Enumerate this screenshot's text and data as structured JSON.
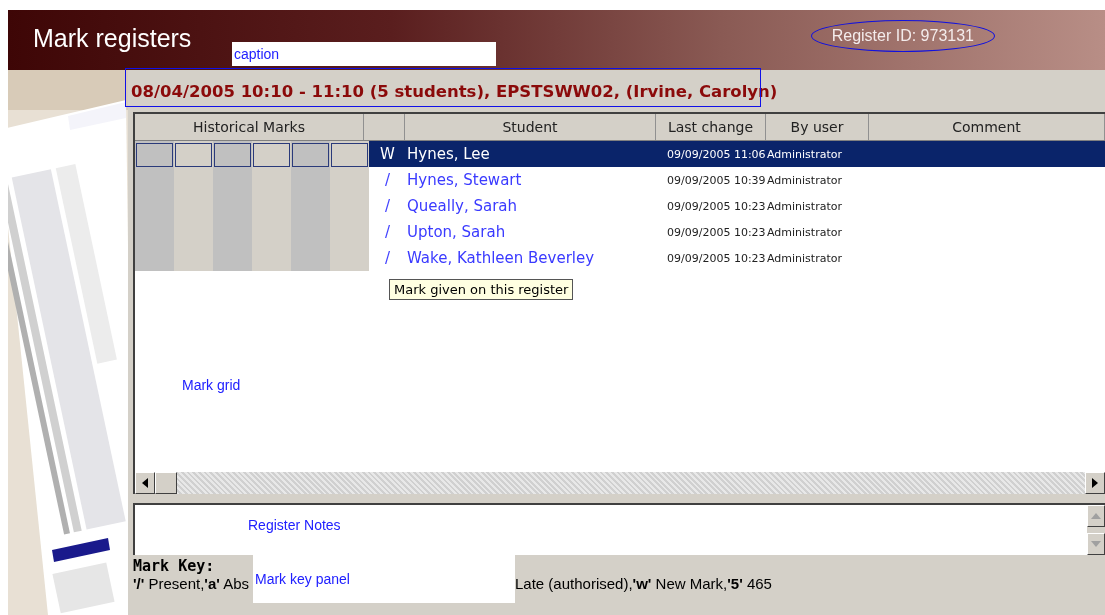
{
  "header": {
    "title": "Mark registers",
    "register_id": "Register ID: 973131",
    "register_id_circled": true
  },
  "caption_label": {
    "text": "caption",
    "boxed": true
  },
  "caption": {
    "text": "08/04/2005 10:10 - 11:10 (5 students), EPSTSWW02, (Irvine, Carolyn)",
    "outlined": true
  },
  "table": {
    "columns": [
      "Historical Marks",
      "",
      "Student",
      "Last change",
      "By user",
      "Comment"
    ],
    "rows": [
      {
        "mark": "W",
        "student": "Hynes, Lee",
        "last_change": "09/09/2005 11:06",
        "by_user": "Administrator",
        "selected": true
      },
      {
        "mark": "/",
        "student": "Hynes, Stewart",
        "last_change": "09/09/2005 10:39",
        "by_user": "Administrator",
        "selected": false
      },
      {
        "mark": "/",
        "student": "Queally, Sarah",
        "last_change": "09/09/2005 10:23",
        "by_user": "Administrator",
        "selected": false
      },
      {
        "mark": "/",
        "student": "Upton, Sarah",
        "last_change": "09/09/2005 10:23",
        "by_user": "Administrator",
        "selected": false
      },
      {
        "mark": "/",
        "student": "Wake, Kathleen Beverley",
        "last_change": "09/09/2005 10:23",
        "by_user": "Administrator",
        "selected": false
      }
    ],
    "tooltip": "Mark given on this register",
    "annotation": "Mark grid"
  },
  "notes": {
    "annotation": "Register Notes"
  },
  "mark_key": {
    "title": "Mark Key:",
    "text_before": "**'/'** Present,**'a'** Abs",
    "text_after": "Late (authorised),**'w'** New Mark,**'5'** 465",
    "annotation": {
      "text": "Mark key panel",
      "boxed": true
    }
  }
}
